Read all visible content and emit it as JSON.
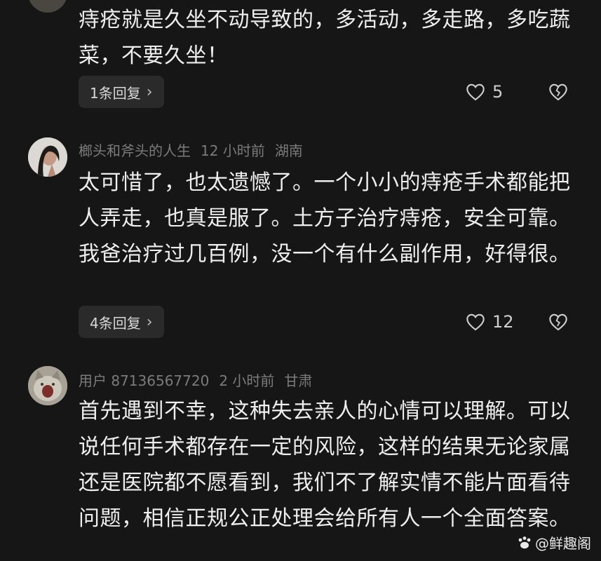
{
  "comments": [
    {
      "text": "痔疮就是久坐不动导致的，多活动，多走路，多吃蔬菜，不要久坐！",
      "reply_label": "1条回复",
      "likes": "5"
    },
    {
      "username": "榔头和斧头的人生",
      "time": "12 小时前",
      "location": "湖南",
      "text": "太可惜了，也太遗憾了。一个小小的痔疮手术都能把人弄走，也真是服了。土方子治疗痔疮，安全可靠。我爸治疗过几百例，没一个有什么副作用，好得很。",
      "reply_label": "4条回复",
      "likes": "12"
    },
    {
      "username": "用户 87136567720",
      "time": "2 小时前",
      "location": "甘肃",
      "text": "首先遇到不幸，这种失去亲人的心情可以理解。可以说任何手术都存在一定的风险，这样的结果无论家属还是医院都不愿看到，我们不了解实情不能片面看待问题，相信正规公正处理会给所有人一个全面答案。"
    }
  ],
  "watermark": "@鲜趣阁",
  "icons": {
    "chevron": "›",
    "like": "heart-icon",
    "dislike": "broken-heart-icon"
  },
  "colors": {
    "background": "#161616",
    "meta": "#7b7b7b",
    "text": "#eeeeee",
    "reply_bg": "#2a2a2a"
  }
}
